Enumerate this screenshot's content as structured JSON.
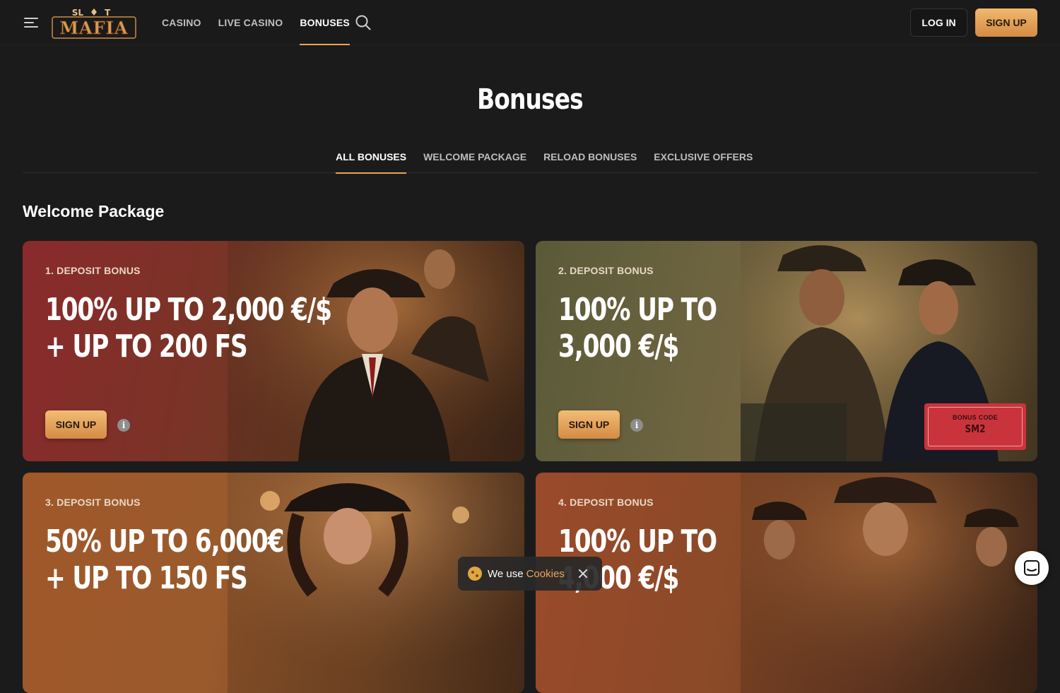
{
  "header": {
    "logo_top": "SL",
    "logo_top_right": "T",
    "logo_main": "MAFIA",
    "nav": [
      {
        "label": "CASINO",
        "active": false
      },
      {
        "label": "LIVE CASINO",
        "active": false
      },
      {
        "label": "BONUSES",
        "active": true
      }
    ],
    "login_label": "LOG IN",
    "signup_label": "SIGN UP"
  },
  "page": {
    "title": "Bonuses",
    "tabs": [
      {
        "label": "ALL BONUSES",
        "active": true
      },
      {
        "label": "WELCOME PACKAGE",
        "active": false
      },
      {
        "label": "RELOAD BONUSES",
        "active": false
      },
      {
        "label": "EXCLUSIVE OFFERS",
        "active": false
      }
    ],
    "section_title": "Welcome Package"
  },
  "cards": [
    {
      "label": "1. DEPOSIT BONUS",
      "line1": "100% UP TO 2,000 €/$",
      "line2": "+ UP TO 200 FS",
      "button": "SIGN UP",
      "info": "i"
    },
    {
      "label": "2. DEPOSIT BONUS",
      "line1": "100% UP TO",
      "line2": "3,000 €/$",
      "button": "SIGN UP",
      "info": "i",
      "bonus_code_label": "BONUS CODE",
      "bonus_code": "SM2"
    },
    {
      "label": "3. DEPOSIT BONUS",
      "line1": "50% UP TO 6,000€",
      "line2": "+ UP TO 150 FS"
    },
    {
      "label": "4. DEPOSIT BONUS",
      "line1": "100% UP TO",
      "line2": "4,000 €/$"
    }
  ],
  "cookie": {
    "text": "We use",
    "link": "Cookies"
  },
  "colors": {
    "accent": "#e8a65a",
    "background": "#1b1b1b",
    "bonus_code": "#c9343c"
  },
  "icons": {
    "menu": "menu-icon",
    "search": "search-icon",
    "info": "info-icon",
    "cookie": "cookie-icon",
    "close": "close-icon",
    "chat": "chat-icon"
  }
}
